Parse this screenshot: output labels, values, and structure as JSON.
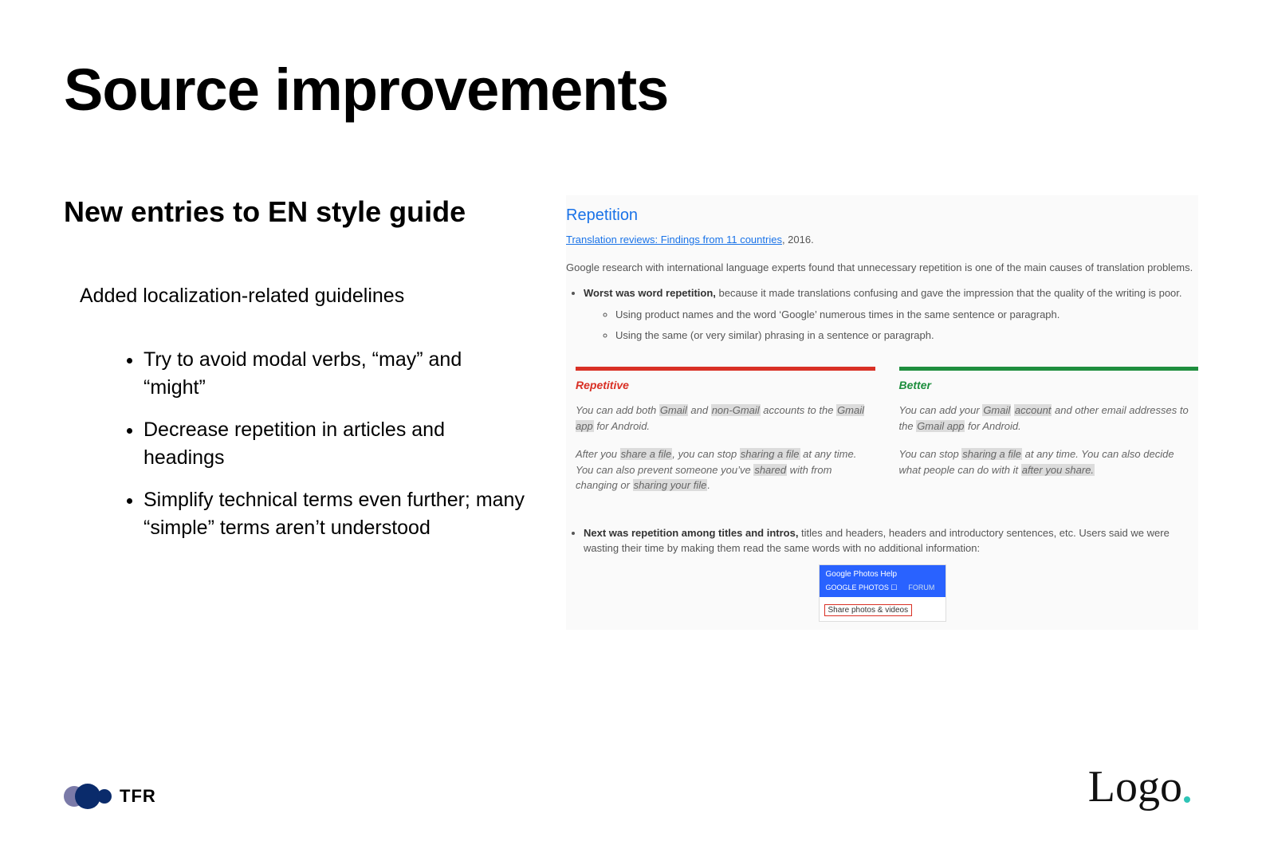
{
  "title": "Source improvements",
  "subheading": "New entries to EN style guide",
  "intro": "Added localization-related guidelines",
  "bullets": [
    "Try to avoid modal verbs, “may” and “might”",
    "Decrease repetition in articles and headings",
    "Simplify technical terms even further; many “simple” terms aren’t understood"
  ],
  "panel": {
    "heading": "Repetition",
    "link_text": "Translation reviews: Findings from 11 countries",
    "link_year": ", 2016.",
    "para": "Google research with international language experts found that unnecessary repetition is one of the main causes of translation problems.",
    "point1_strong": "Worst was word repetition,",
    "point1_rest": " because it made translations confusing and gave the impression that the quality of the writing is poor.",
    "sub1": "Using product names and the word ‘Google’ numerous times in the same sentence or paragraph.",
    "sub2": "Using the same (or very similar) phrasing in a sentence or paragraph.",
    "compare": {
      "left_label": "Repetitive",
      "right_label": "Better",
      "left_ex1_a": "You can add both ",
      "left_ex1_h1": "Gmail",
      "left_ex1_b": " and ",
      "left_ex1_h2": "non-Gmail",
      "left_ex1_c": " accounts to the ",
      "left_ex1_h3": "Gmail app",
      "left_ex1_d": " for Android.",
      "right_ex1_a": "You can add your ",
      "right_ex1_h1": "Gmail",
      "right_ex1_b": " ",
      "right_ex1_h2": "account",
      "right_ex1_c": " and other email addresses to the ",
      "right_ex1_h3": "Gmail app",
      "right_ex1_d": " for Android.",
      "left_ex2_a": "After you ",
      "left_ex2_h1": "share a file",
      "left_ex2_b": ", you can stop ",
      "left_ex2_h2": "sharing a file",
      "left_ex2_c": " at any time. You can also prevent someone you’ve ",
      "left_ex2_h3": "shared",
      "left_ex2_d": " with from changing or ",
      "left_ex2_h4": "sharing your file",
      "left_ex2_e": ".",
      "right_ex2_a": "You can stop ",
      "right_ex2_h1": "sharing a file",
      "right_ex2_b": " at any time. You can also decide what people can do with it ",
      "right_ex2_h2": "after you share.",
      "right_ex2_c": ""
    },
    "point2_strong": "Next was repetition among titles and intros,",
    "point2_rest": " titles and headers, headers and introductory sentences, etc. Users said we were wasting their time by making them read the same words with no additional information:",
    "help": {
      "header": "Google Photos Help",
      "tab1": "GOOGLE PHOTOS ☐",
      "tab2": "FORUM",
      "boxed": "Share photos & videos"
    }
  },
  "footer": {
    "tfr": "TFR",
    "logo": "Logo"
  }
}
